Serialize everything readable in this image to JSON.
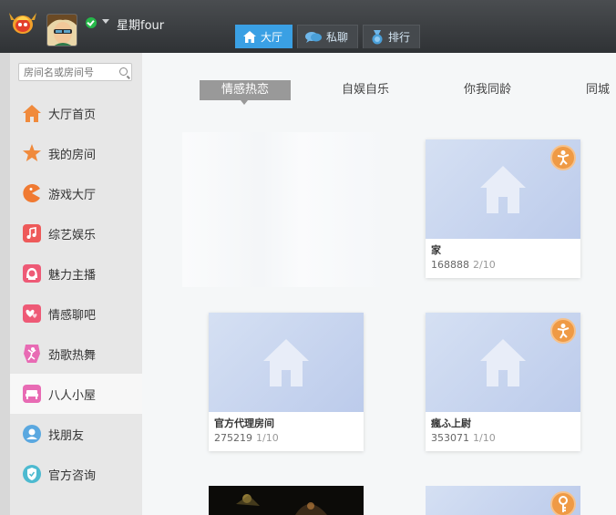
{
  "user": {
    "name": "星期four",
    "status_color": "#26b84a"
  },
  "nav": {
    "tabs": [
      {
        "label": "大厅",
        "icon": "home-icon",
        "active": true
      },
      {
        "label": "私聊",
        "icon": "chat-bubble-icon",
        "active": false
      },
      {
        "label": "排行",
        "icon": "medal-icon",
        "active": false
      }
    ]
  },
  "sidebar": {
    "search_placeholder": "房间名或房间号",
    "items": [
      {
        "label": "大厅首页",
        "icon": "house-icon",
        "color": "#f08a3c"
      },
      {
        "label": "我的房间",
        "icon": "star-icon",
        "color": "#f08a3c"
      },
      {
        "label": "游戏大厅",
        "icon": "pacman-icon",
        "color": "#f07a32"
      },
      {
        "label": "综艺娱乐",
        "icon": "music-note-icon",
        "color": "#ee5a5a"
      },
      {
        "label": "魅力主播",
        "icon": "girl-icon",
        "color": "#ee5a76"
      },
      {
        "label": "情感聊吧",
        "icon": "hearts-icon",
        "color": "#ee5a76"
      },
      {
        "label": "劲歌热舞",
        "icon": "dancer-icon",
        "color": "#e86bb4"
      },
      {
        "label": "八人小屋",
        "icon": "sofa-icon",
        "color": "#e86bb4",
        "active": true
      },
      {
        "label": "找朋友",
        "icon": "person-circle-icon",
        "color": "#5aa8e0"
      },
      {
        "label": "官方咨询",
        "icon": "shield-icon",
        "color": "#4dbad0"
      }
    ]
  },
  "categories": {
    "tabs": [
      {
        "label": "情感热恋",
        "active": true
      },
      {
        "label": "自娱自乐",
        "active": false
      },
      {
        "label": "你我同龄",
        "active": false
      },
      {
        "label": "同城",
        "active": false
      }
    ]
  },
  "rooms": [
    {
      "title": "家",
      "id": "168888",
      "occupancy": "2/10",
      "badge": "kid-icon"
    },
    {
      "title": "官方代理房间",
      "id": "275219",
      "occupancy": "1/10",
      "badge": null
    },
    {
      "title": "瘋ふ上尉",
      "id": "353071",
      "occupancy": "1/10",
      "badge": "kid-icon"
    }
  ],
  "colors": {
    "accent": "#3aa0e4",
    "badge": "#ef9a45",
    "thumb": "#c8d5ef"
  }
}
